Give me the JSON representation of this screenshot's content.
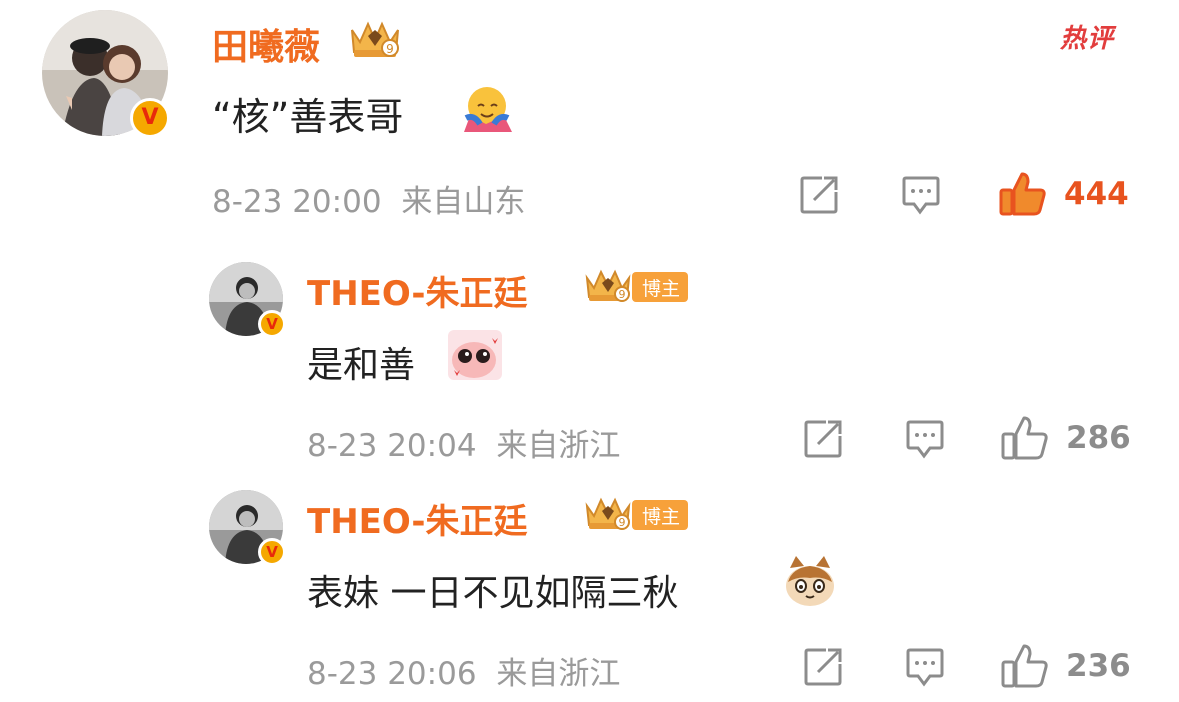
{
  "hot_label": "热评",
  "comments": [
    {
      "author": "田曦薇",
      "text": "“核”善表哥",
      "date": "8-23 20:00",
      "location": "来自山东",
      "likes": "444",
      "liked": true,
      "is_blogger": false
    },
    {
      "author": "THEO-朱正廷",
      "text": "是和善",
      "date": "8-23 20:04",
      "location": "来自浙江",
      "likes": "286",
      "liked": false,
      "is_blogger": true,
      "blogger_label": "博主"
    },
    {
      "author": "THEO-朱正廷",
      "text": "表妹 一日不见如隔三秋",
      "date": "8-23 20:06",
      "location": "来自浙江",
      "likes": "236",
      "liked": false,
      "is_blogger": true,
      "blogger_label": "博主"
    }
  ],
  "crown_level": "9",
  "verified_mark": "V",
  "colors": {
    "accent": "#f06b20",
    "like_active": "#e8531f",
    "meta": "#9a9a9a"
  }
}
